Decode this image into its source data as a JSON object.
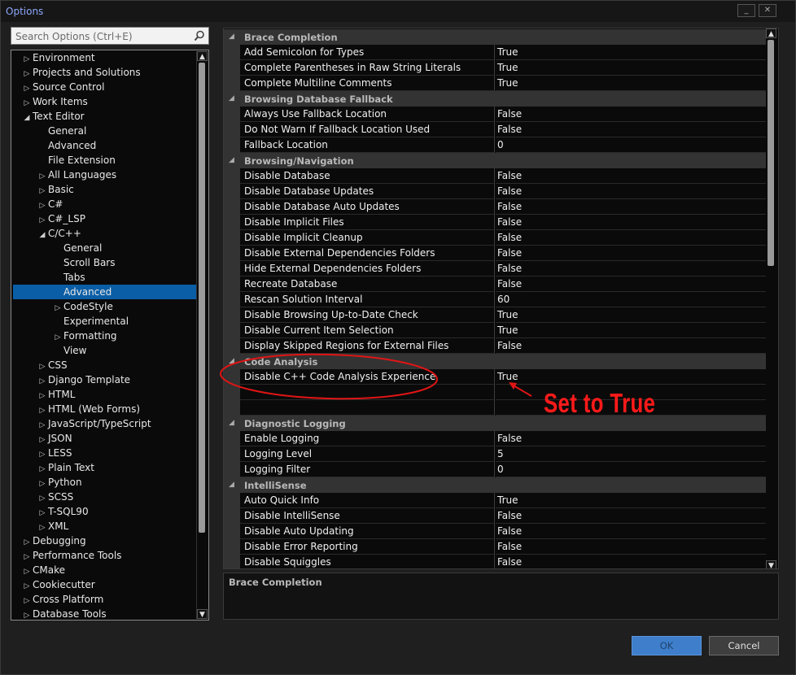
{
  "window": {
    "title": "Options",
    "help_glyph": "_",
    "close_glyph": "✕"
  },
  "search": {
    "placeholder": "Search Options (Ctrl+E)"
  },
  "tree": [
    {
      "label": "Environment",
      "level": 0,
      "expander": "▷"
    },
    {
      "label": "Projects and Solutions",
      "level": 0,
      "expander": "▷"
    },
    {
      "label": "Source Control",
      "level": 0,
      "expander": "▷"
    },
    {
      "label": "Work Items",
      "level": 0,
      "expander": "▷"
    },
    {
      "label": "Text Editor",
      "level": 0,
      "expander": "◢"
    },
    {
      "label": "General",
      "level": 1,
      "expander": ""
    },
    {
      "label": "Advanced",
      "level": 1,
      "expander": ""
    },
    {
      "label": "File Extension",
      "level": 1,
      "expander": ""
    },
    {
      "label": "All Languages",
      "level": 1,
      "expander": "▷"
    },
    {
      "label": "Basic",
      "level": 1,
      "expander": "▷"
    },
    {
      "label": "C#",
      "level": 1,
      "expander": "▷"
    },
    {
      "label": "C#_LSP",
      "level": 1,
      "expander": "▷"
    },
    {
      "label": "C/C++",
      "level": 1,
      "expander": "◢"
    },
    {
      "label": "General",
      "level": 2,
      "expander": ""
    },
    {
      "label": "Scroll Bars",
      "level": 2,
      "expander": ""
    },
    {
      "label": "Tabs",
      "level": 2,
      "expander": ""
    },
    {
      "label": "Advanced",
      "level": 2,
      "expander": "",
      "selected": true
    },
    {
      "label": "CodeStyle",
      "level": 2,
      "expander": "▷"
    },
    {
      "label": "Experimental",
      "level": 2,
      "expander": ""
    },
    {
      "label": "Formatting",
      "level": 2,
      "expander": "▷"
    },
    {
      "label": "View",
      "level": 2,
      "expander": ""
    },
    {
      "label": "CSS",
      "level": 1,
      "expander": "▷"
    },
    {
      "label": "Django Template",
      "level": 1,
      "expander": "▷"
    },
    {
      "label": "HTML",
      "level": 1,
      "expander": "▷"
    },
    {
      "label": "HTML (Web Forms)",
      "level": 1,
      "expander": "▷"
    },
    {
      "label": "JavaScript/TypeScript",
      "level": 1,
      "expander": "▷"
    },
    {
      "label": "JSON",
      "level": 1,
      "expander": "▷"
    },
    {
      "label": "LESS",
      "level": 1,
      "expander": "▷"
    },
    {
      "label": "Plain Text",
      "level": 1,
      "expander": "▷"
    },
    {
      "label": "Python",
      "level": 1,
      "expander": "▷"
    },
    {
      "label": "SCSS",
      "level": 1,
      "expander": "▷"
    },
    {
      "label": "T-SQL90",
      "level": 1,
      "expander": "▷"
    },
    {
      "label": "XML",
      "level": 1,
      "expander": "▷"
    },
    {
      "label": "Debugging",
      "level": 0,
      "expander": "▷"
    },
    {
      "label": "Performance Tools",
      "level": 0,
      "expander": "▷"
    },
    {
      "label": "CMake",
      "level": 0,
      "expander": "▷"
    },
    {
      "label": "Cookiecutter",
      "level": 0,
      "expander": "▷"
    },
    {
      "label": "Cross Platform",
      "level": 0,
      "expander": "▷"
    },
    {
      "label": "Database Tools",
      "level": 0,
      "expander": "▷"
    }
  ],
  "grid": [
    {
      "category": "Brace Completion",
      "rows": [
        [
          "Add Semicolon for Types",
          "True"
        ],
        [
          "Complete Parentheses in Raw String Literals",
          "True"
        ],
        [
          "Complete Multiline Comments",
          "True"
        ]
      ]
    },
    {
      "category": "Browsing Database Fallback",
      "rows": [
        [
          "Always Use Fallback Location",
          "False"
        ],
        [
          "Do Not Warn If Fallback Location Used",
          "False"
        ],
        [
          "Fallback Location",
          "0"
        ]
      ]
    },
    {
      "category": "Browsing/Navigation",
      "rows": [
        [
          "Disable Database",
          "False"
        ],
        [
          "Disable Database Updates",
          "False"
        ],
        [
          "Disable Database Auto Updates",
          "False"
        ],
        [
          "Disable Implicit Files",
          "False"
        ],
        [
          "Disable Implicit Cleanup",
          "False"
        ],
        [
          "Disable External Dependencies Folders",
          "False"
        ],
        [
          "Hide External Dependencies Folders",
          "False"
        ],
        [
          "Recreate Database",
          "False"
        ],
        [
          "Rescan Solution Interval",
          "60"
        ],
        [
          "Disable Browsing Up-to-Date Check",
          "True"
        ],
        [
          "Disable Current Item Selection",
          "True"
        ],
        [
          "Display Skipped Regions for External Files",
          "False"
        ]
      ]
    },
    {
      "category": "Code Analysis",
      "rows": [
        [
          "Disable C++ Code Analysis Experience",
          "True"
        ],
        [
          "",
          ""
        ],
        [
          "",
          ""
        ]
      ]
    },
    {
      "category": "Diagnostic Logging",
      "rows": [
        [
          "Enable Logging",
          "False"
        ],
        [
          "Logging Level",
          "5"
        ],
        [
          "Logging Filter",
          "0"
        ]
      ]
    },
    {
      "category": "IntelliSense",
      "rows": [
        [
          "Auto Quick Info",
          "True"
        ],
        [
          "Disable IntelliSense",
          "False"
        ],
        [
          "Disable Auto Updating",
          "False"
        ],
        [
          "Disable Error Reporting",
          "False"
        ],
        [
          "Disable Squiggles",
          "False"
        ]
      ]
    }
  ],
  "description": {
    "title": "Brace Completion"
  },
  "buttons": {
    "ok": "OK",
    "cancel": "Cancel"
  },
  "annotation": {
    "text": "Set to True",
    "color": "#ff1a1a"
  },
  "icons": {
    "search": "search-icon",
    "scroll_up": "▲",
    "scroll_down": "▼"
  }
}
